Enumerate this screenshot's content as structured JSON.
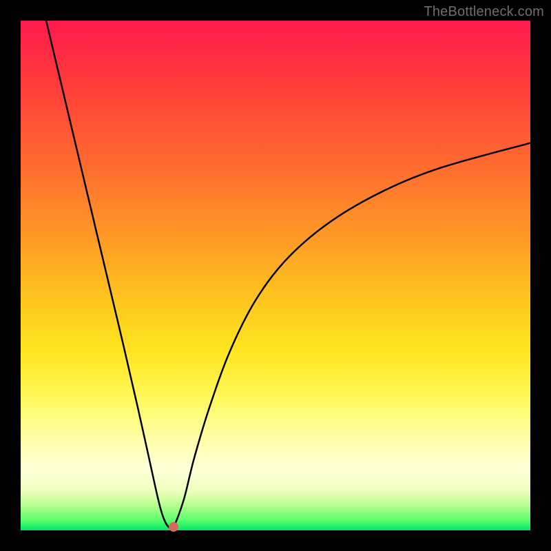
{
  "watermark": "TheBottleneck.com",
  "chart_data": {
    "type": "line",
    "title": "",
    "xlabel": "",
    "ylabel": "",
    "xlim": [
      0,
      100
    ],
    "ylim": [
      0,
      100
    ],
    "series": [
      {
        "name": "curve",
        "x": [
          5,
          10,
          15,
          20,
          23,
          25,
          27,
          28,
          29,
          30,
          32,
          34,
          37,
          41,
          46,
          52,
          60,
          70,
          82,
          100
        ],
        "y": [
          100,
          79,
          58,
          37,
          24,
          15,
          6,
          2.5,
          0.7,
          0.7,
          6,
          14,
          24,
          35,
          45,
          53,
          60,
          66,
          71,
          76
        ]
      }
    ],
    "marker": {
      "x": 30,
      "y": 0.7
    },
    "background_gradient": {
      "top": "#ff1a4d",
      "mid": "#ffd41f",
      "bottom": "#00e765"
    }
  }
}
